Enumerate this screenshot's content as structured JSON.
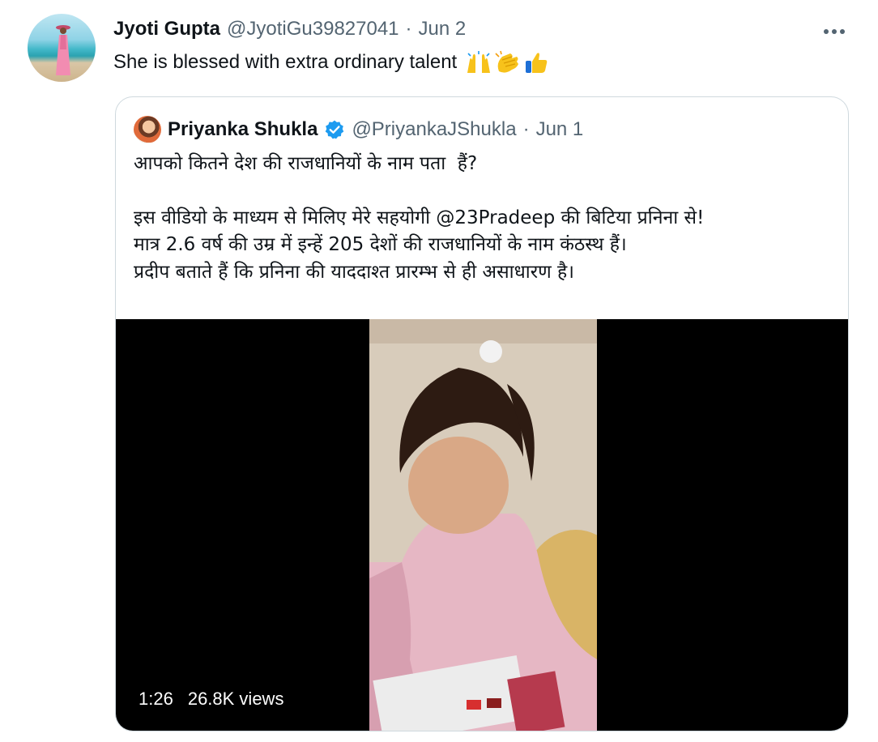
{
  "tweet": {
    "author_name": "Jyoti Gupta",
    "author_handle": "@JyotiGu39827041",
    "separator": "·",
    "date": "Jun 2",
    "text": "She is blessed with extra ordinary talent",
    "emojis": [
      "raising-hands-emoji",
      "clapping-hands-emoji",
      "thumbs-up-emoji"
    ],
    "more_icon": "more-horizontal-icon"
  },
  "quoted": {
    "author_name": "Priyanka Shukla",
    "verified_icon": "verified-badge-icon",
    "author_handle": "@PriyankaJShukla",
    "separator": "·",
    "date": "Jun 1",
    "line1": "आपको कितने देश की राजधानियों के नाम पता  हैं?",
    "line2": "इस वीडियो के माध्यम से मिलिए मेरे सहयोगी @23Pradeep की बिटिया प्रनिना से!",
    "line3": "मात्र 2.6 वर्ष की उम्र में इन्हें 205 देशों की राजधानियों के नाम कंठस्थ हैं।",
    "line4": "प्रदीप बताते हैं कि प्रनिना की याददाश्त प्रारम्भ से ही असाधारण है।",
    "video": {
      "duration": "1:26",
      "views": "26.8K views"
    }
  },
  "colors": {
    "text_primary": "#0f1419",
    "text_secondary": "#536471",
    "border": "#cfd9de",
    "verified_blue": "#1d9bf0"
  }
}
